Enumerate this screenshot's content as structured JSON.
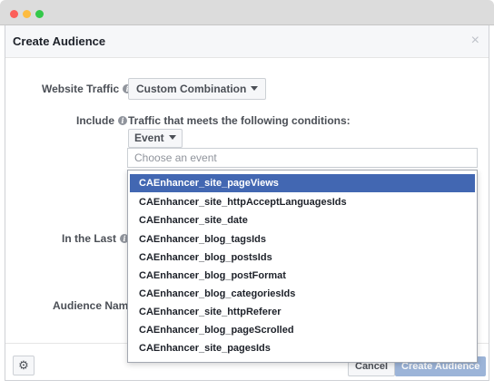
{
  "window_controls": [
    "close",
    "minimize",
    "zoom"
  ],
  "dialog": {
    "title": "Create Audience",
    "close_glyph": "×"
  },
  "form": {
    "website_traffic": {
      "label": "Website Traffic",
      "value": "Custom Combination"
    },
    "include": {
      "label": "Include",
      "description": "Traffic that meets the following conditions:",
      "filter_type": "Event",
      "event_placeholder": "Choose an event"
    },
    "in_the_last": {
      "label": "In the Last"
    },
    "audience_name": {
      "label": "Audience Name"
    }
  },
  "event_dropdown": {
    "selected_index": 0,
    "items": [
      "CAEnhancer_site_pageViews",
      "CAEnhancer_site_httpAcceptLanguagesIds",
      "CAEnhancer_site_date",
      "CAEnhancer_blog_tagsIds",
      "CAEnhancer_blog_postsIds",
      "CAEnhancer_blog_postFormat",
      "CAEnhancer_blog_categoriesIds",
      "CAEnhancer_site_httpReferer",
      "CAEnhancer_blog_pageScrolled",
      "CAEnhancer_site_pagesIds"
    ]
  },
  "footer": {
    "settings_icon": "gear-icon",
    "cancel_label": "Cancel",
    "create_label": "Create Audience"
  },
  "colors": {
    "selected_row": "#4267b2",
    "primary_button_disabled": "#9cb4d8"
  }
}
